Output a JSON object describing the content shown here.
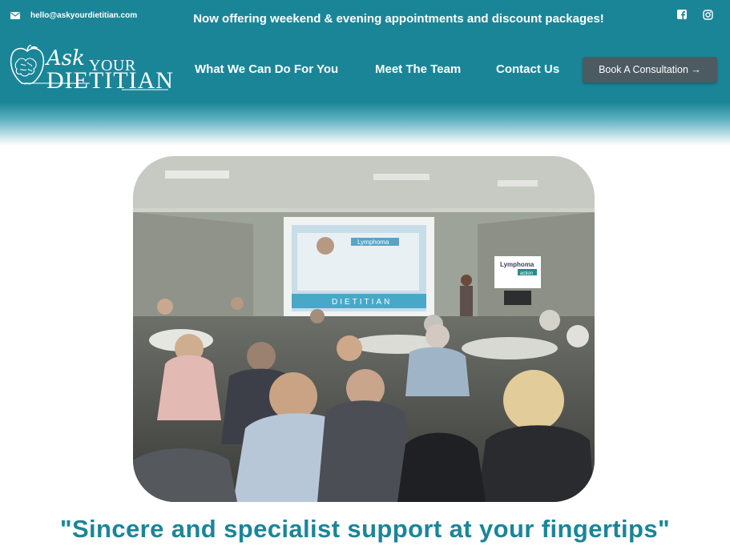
{
  "topbar": {
    "email": "hello@askyourdietitian.com",
    "announcement": "Now offering weekend & evening appointments and discount packages!",
    "social": [
      "facebook-icon",
      "instagram-icon"
    ]
  },
  "brand": {
    "ask": "Ask",
    "your": "YOUR",
    "dietitian": "DIETITIAN"
  },
  "nav": {
    "items": [
      "What We Can Do For You",
      "Meet The Team",
      "Contact Us"
    ],
    "cta": "Book A Consultation →"
  },
  "hero": {
    "slide_title": "Lymphoma action",
    "slide_logo": "DIETITIAN",
    "banner_title": "Lymphoma",
    "banner_sub": "action",
    "tagline": "\"Sincere and specialist support at your fingertips\""
  },
  "colors": {
    "brand": "#1b8598",
    "cta_bg": "#4c5a62",
    "text_light": "#ffffff"
  }
}
